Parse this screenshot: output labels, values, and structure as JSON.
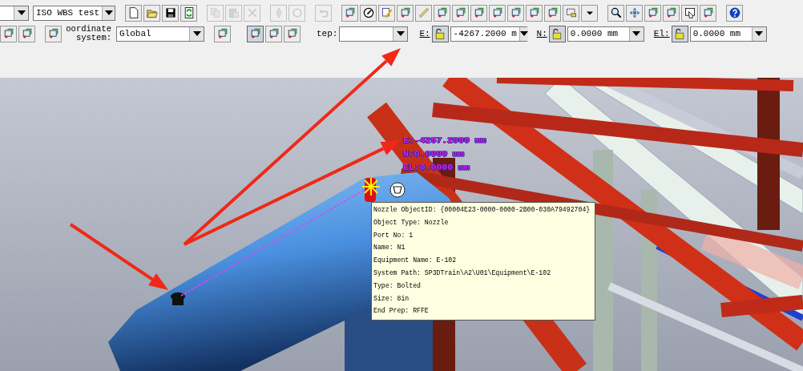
{
  "toolbar_top": {
    "workspace": "ISO WBS test",
    "buttons": [
      {
        "disabled": false
      },
      {
        "disabled": false
      },
      {
        "disabled": false
      },
      {
        "disabled": false
      },
      {
        "disabled": true
      },
      {
        "disabled": true
      },
      {
        "disabled": true
      },
      {
        "disabled": true
      },
      {
        "disabled": true
      },
      {
        "disabled": true
      },
      {
        "disabled": false
      },
      {
        "disabled": false
      },
      {
        "disabled": false
      },
      {
        "disabled": false
      },
      {
        "disabled": false
      },
      {
        "disabled": false
      },
      {
        "disabled": false
      },
      {
        "disabled": false
      },
      {
        "disabled": false
      },
      {
        "disabled": false
      },
      {
        "disabled": false
      },
      {
        "disabled": false
      },
      {
        "disabled": false
      },
      {
        "disabled": false
      },
      {
        "disabled": false
      },
      {
        "disabled": false
      },
      {
        "disabled": false
      },
      {
        "disabled": false
      },
      {
        "disabled": false
      },
      {
        "disabled": false
      },
      {
        "disabled": false
      }
    ]
  },
  "toolbar_bottom": {
    "coordinate_system_label": "oordinate system:",
    "coordinate_system": "Global",
    "step_label": "tep:",
    "coordinates": [
      {
        "label": "E:",
        "value": "-4267.2000 m"
      },
      {
        "label": "N:",
        "value": "0.0000 mm"
      },
      {
        "label": "El:",
        "value": "0.0000 mm"
      }
    ]
  },
  "viewport": {
    "readout": [
      "E:-4267.2000 mm",
      "N:0.0000 mm",
      "EL:0.0000 mm"
    ],
    "tooltip": [
      "Nozzle ObjectID: {00004E23-0000-0000-2B00-030A79492704}",
      "Object Type: Nozzle",
      "Port No: 1",
      "Name: N1",
      "Equipment Name: E-102",
      "System Path: SP3DTrain\\A2\\U01\\Equipment\\E-102",
      "Type: Bolted",
      "Size: 8in",
      "End Prep: RFFE"
    ]
  }
}
